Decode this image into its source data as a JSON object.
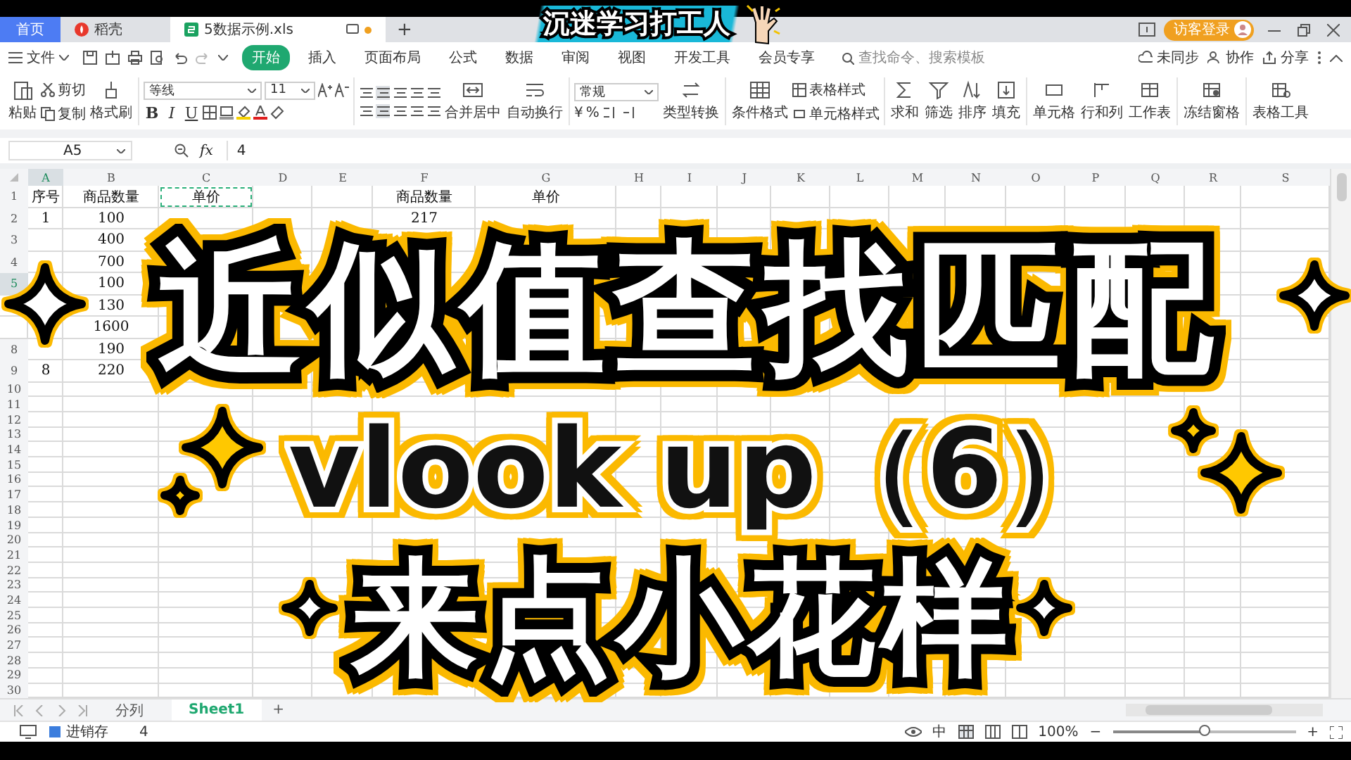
{
  "logo": {
    "text": "沉迷学习打工人"
  },
  "tabs": [
    {
      "label": "首页",
      "kind": "home",
      "selected": false
    },
    {
      "label": "稻壳",
      "kind": "docer",
      "selected": false
    },
    {
      "label": "5数据示例.xls",
      "kind": "sheet",
      "selected": true
    }
  ],
  "add_tab": "+",
  "account": {
    "label": "访客登录"
  },
  "menu": {
    "file": "文件",
    "items": [
      {
        "label": "开始",
        "selected": true
      },
      {
        "label": "插入",
        "selected": false
      },
      {
        "label": "页面布局",
        "selected": false
      },
      {
        "label": "公式",
        "selected": false
      },
      {
        "label": "数据",
        "selected": false
      },
      {
        "label": "审阅",
        "selected": false
      },
      {
        "label": "视图",
        "selected": false
      },
      {
        "label": "开发工具",
        "selected": false
      },
      {
        "label": "会员专享",
        "selected": false
      }
    ],
    "search": {
      "placeholder": "查找命令、搜索模板"
    },
    "actions": [
      "未同步",
      "协作",
      "分享"
    ]
  },
  "ribbon": {
    "paste": "粘贴",
    "cut": "剪切",
    "copy": "复制",
    "format_painter": "格式刷",
    "font": "等线",
    "size": "11",
    "styles": [
      "B",
      "I",
      "U"
    ],
    "merge": "合并居中",
    "wrap": "自动换行",
    "number_format": "常规",
    "number_symbols": [
      "¥",
      "%"
    ],
    "convert": "类型转换",
    "conditional": "条件格式",
    "table_style": "表格样式",
    "cell_style": "单元格样式",
    "tools": [
      "求和",
      "筛选",
      "排序",
      "填充",
      "单元格",
      "行和列",
      "工作表",
      "冻结窗格",
      "表格工具"
    ]
  },
  "formula_bar": {
    "cell": "A5",
    "fx": "fx",
    "value": "4"
  },
  "sheet": {
    "columns": [
      {
        "label": "A",
        "selected": true
      },
      {
        "label": "B",
        "selected": false
      },
      {
        "label": "C",
        "selected": false
      },
      {
        "label": "D",
        "selected": false
      },
      {
        "label": "E",
        "selected": false
      },
      {
        "label": "F",
        "selected": false
      },
      {
        "label": "G",
        "selected": false
      },
      {
        "label": "H",
        "selected": false
      },
      {
        "label": "I",
        "selected": false
      },
      {
        "label": "J",
        "selected": false
      },
      {
        "label": "K",
        "selected": false
      },
      {
        "label": "L",
        "selected": false
      },
      {
        "label": "M",
        "selected": false
      },
      {
        "label": "N",
        "selected": false
      },
      {
        "label": "O",
        "selected": false
      },
      {
        "label": "P",
        "selected": false
      },
      {
        "label": "Q",
        "selected": false
      },
      {
        "label": "R",
        "selected": false
      },
      {
        "label": "S",
        "selected": false
      }
    ],
    "rows": [
      {
        "label": "1",
        "selected": false,
        "cells": [
          {
            "text": "序号",
            "marquee": false
          },
          {
            "text": "商品数量",
            "marquee": false
          },
          {
            "text": "单价",
            "marquee": true
          },
          null,
          null,
          {
            "text": "商品数量",
            "marquee": false
          },
          {
            "text": "单价",
            "marquee": false
          }
        ]
      },
      {
        "label": "2",
        "selected": false,
        "cells": [
          {
            "text": "1",
            "marquee": false
          },
          {
            "text": "100",
            "marquee": false
          },
          null,
          null,
          null,
          {
            "text": "217",
            "marquee": false
          }
        ]
      },
      {
        "label": "3",
        "selected": false,
        "cells": [
          null,
          {
            "text": "400",
            "marquee": false
          }
        ]
      },
      {
        "label": "4",
        "selected": false,
        "cells": [
          null,
          {
            "text": "700",
            "marquee": false
          }
        ]
      },
      {
        "label": "5",
        "selected": true,
        "cells": [
          null,
          {
            "text": "100",
            "marquee": false
          }
        ]
      },
      {
        "selected": false,
        "cells": [
          null,
          {
            "text": "130",
            "marquee": false
          }
        ]
      },
      {
        "selected": false,
        "cells": [
          null,
          {
            "text": "1600",
            "marquee": false
          }
        ]
      },
      {
        "label": "8",
        "selected": false,
        "cells": [
          null,
          {
            "text": "190",
            "marquee": false
          }
        ]
      },
      {
        "label": "9",
        "selected": false,
        "cells": [
          {
            "text": "8",
            "marquee": false
          },
          {
            "text": "220",
            "marquee": false
          }
        ]
      },
      {
        "label": "10",
        "selected": false,
        "cells": []
      },
      {
        "label": "11",
        "selected": false,
        "cells": []
      },
      {
        "label": "12",
        "selected": false,
        "cells": []
      },
      {
        "label": "13",
        "selected": false,
        "cells": []
      },
      {
        "label": "14",
        "selected": false,
        "cells": []
      },
      {
        "label": "15",
        "selected": false,
        "cells": []
      },
      {
        "label": "16",
        "selected": false,
        "cells": []
      },
      {
        "label": "17",
        "selected": false,
        "cells": []
      },
      {
        "label": "18",
        "selected": false,
        "cells": []
      },
      {
        "label": "19",
        "selected": false,
        "cells": []
      },
      {
        "label": "20",
        "selected": false,
        "cells": []
      },
      {
        "label": "21",
        "selected": false,
        "cells": []
      },
      {
        "label": "22",
        "selected": false,
        "cells": []
      },
      {
        "label": "23",
        "selected": false,
        "cells": []
      },
      {
        "label": "24",
        "selected": false,
        "cells": []
      },
      {
        "label": "25",
        "selected": false,
        "cells": []
      },
      {
        "label": "26",
        "selected": false,
        "cells": []
      },
      {
        "label": "27",
        "selected": false,
        "cells": []
      },
      {
        "label": "28",
        "selected": false,
        "cells": []
      },
      {
        "label": "29",
        "selected": false,
        "cells": []
      },
      {
        "label": "30",
        "selected": false,
        "cells": []
      }
    ]
  },
  "sheet_tabs": [
    {
      "label": "分列",
      "selected": false
    },
    {
      "label": "Sheet1",
      "selected": true
    }
  ],
  "add_sheet": "+",
  "status": {
    "macro": "进销存",
    "value": "4",
    "ime": "中",
    "zoom": "100%",
    "zoom_out": "−",
    "zoom_in": "+",
    "zoom_slider": {
      "level": 0.5
    }
  },
  "overlay": {
    "title": "近似值查找匹配",
    "subtitle": "vlook up（6）",
    "tagline": "来点小花样"
  }
}
